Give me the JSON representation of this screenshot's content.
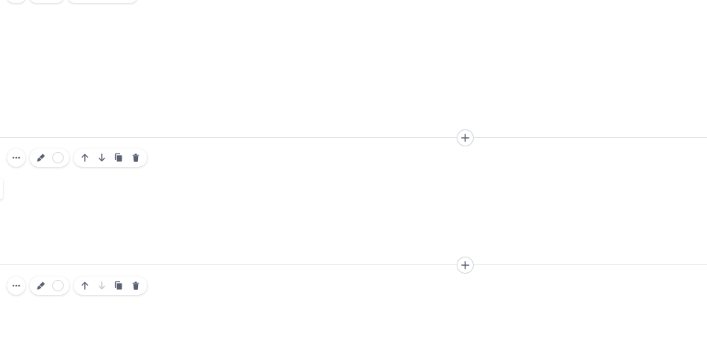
{
  "colors": {
    "divider": "#e4e4e7",
    "icon": "#5b6072",
    "icon_muted": "#b7bac4",
    "background": "#ffffff"
  },
  "icons": {
    "more": "more-horizontal-icon",
    "style": "paint-brush-icon",
    "color": "color-circle",
    "move_up": "arrow-up-icon",
    "move_down": "arrow-down-icon",
    "duplicate": "copy-icon",
    "delete": "trash-icon",
    "add": "plus-icon"
  },
  "sections": [
    {
      "id": "section-1",
      "move_down_enabled": true
    },
    {
      "id": "section-2",
      "move_down_enabled": false
    }
  ]
}
